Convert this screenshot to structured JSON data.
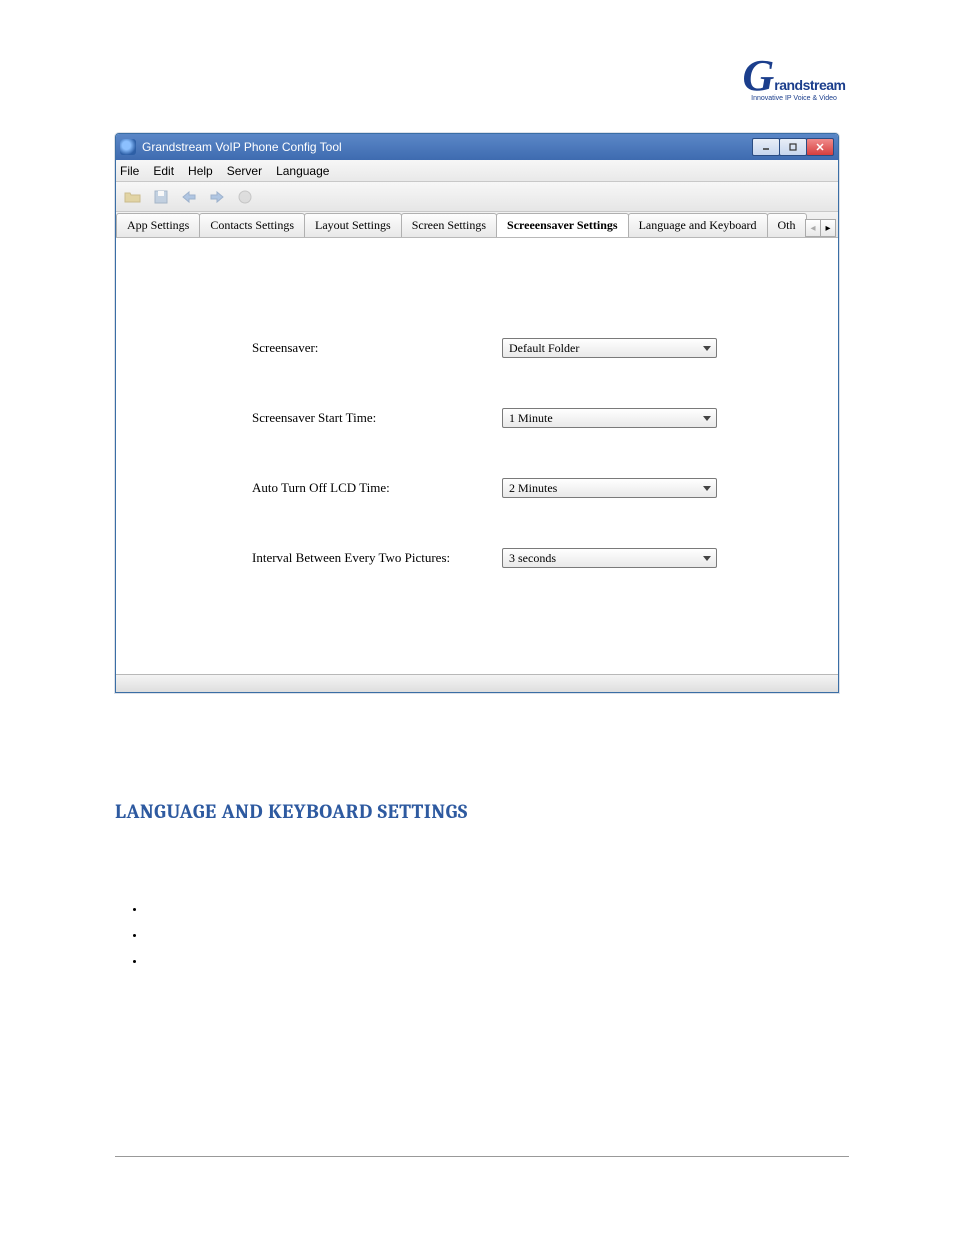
{
  "logo": {
    "word": "randstream",
    "tagline": "Innovative IP Voice & Video"
  },
  "window": {
    "title": "Grandstream VoIP Phone Config Tool",
    "menu": [
      "File",
      "Edit",
      "Help",
      "Server",
      "Language"
    ],
    "tabs": [
      {
        "label": "App Settings"
      },
      {
        "label": "Contacts Settings"
      },
      {
        "label": "Layout Settings"
      },
      {
        "label": "Screen Settings"
      },
      {
        "label": "Screeensaver Settings",
        "active": true
      },
      {
        "label": "Language and Keyboard"
      },
      {
        "label": "Oth"
      }
    ],
    "fields": [
      {
        "label": "Screensaver:",
        "value": "Default Folder"
      },
      {
        "label": "Screensaver Start Time:",
        "value": "1 Minute"
      },
      {
        "label": "Auto Turn Off LCD Time:",
        "value": "2 Minutes"
      },
      {
        "label": "Interval Between Every Two Pictures:",
        "value": "3 seconds"
      }
    ]
  },
  "section_heading": "LANGUAGE AND KEYBOARD SETTINGS",
  "bullets": [
    "",
    "",
    ""
  ]
}
